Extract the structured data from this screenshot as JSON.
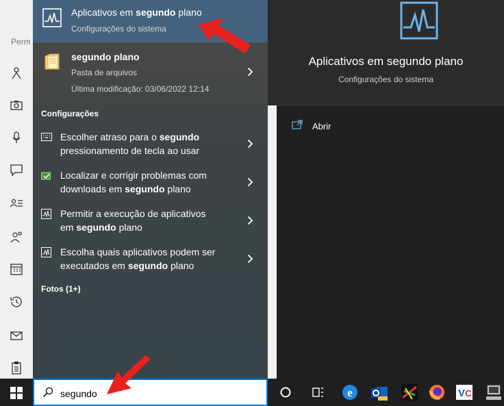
{
  "background_window": {
    "partial_label": "Perm",
    "icons": [
      "person-icon",
      "camera-icon",
      "microphone-icon",
      "chat-icon",
      "contacts-icon",
      "people-icon",
      "calendar-icon",
      "history-icon",
      "mail-icon",
      "clipboard-icon"
    ]
  },
  "top_result": {
    "title_pre": "Aplicativos em ",
    "title_bold": "segundo",
    "title_post": " plano",
    "subtitle": "Configurações do sistema",
    "icon": "activity-chart-icon"
  },
  "folder_result": {
    "title": "segundo plano",
    "type": "Pasta de arquivos",
    "modified": "Última modificação: 03/06/2022 12:14",
    "icon": "folder-icon"
  },
  "settings_section": {
    "header": "Configurações",
    "items": [
      {
        "line1_pre": "Escolher atraso para o ",
        "line1_bold": "segundo",
        "line1_post": "",
        "line2_pre": "pressionamento de tecla ao usar",
        "line2_bold": "",
        "line2_post": "",
        "icon": "keyboard-icon"
      },
      {
        "line1_pre": "Localizar e corrigir problemas com",
        "line1_bold": "",
        "line1_post": "",
        "line2_pre": "downloads em ",
        "line2_bold": "segundo",
        "line2_post": " plano",
        "icon": "troubleshoot-icon"
      },
      {
        "line1_pre": "Permitir a execução de aplicativos",
        "line1_bold": "",
        "line1_post": "",
        "line2_pre": "em ",
        "line2_bold": "segundo",
        "line2_post": " plano",
        "icon": "activity-chart-icon"
      },
      {
        "line1_pre": "Escolha quais aplicativos podem ser",
        "line1_bold": "",
        "line1_post": "",
        "line2_pre": "executados em ",
        "line2_bold": "segundo",
        "line2_post": " plano",
        "icon": "activity-chart-icon"
      }
    ]
  },
  "photos_section": {
    "header": "Fotos (1+)"
  },
  "detail": {
    "title": "Aplicativos em segundo plano",
    "subtitle": "Configurações do sistema",
    "open_label": "Abrir",
    "icon": "activity-chart-icon"
  },
  "search": {
    "query": "segundo",
    "icon": "search-icon"
  },
  "taskbar": {
    "icons": [
      "windows-start-icon",
      "cortana-icon",
      "task-view-icon",
      "edge-icon",
      "outlook-icon",
      "kaspersky-icon",
      "firefox-icon",
      "vnc-icon",
      "network-computer-icon"
    ]
  },
  "colors": {
    "accent": "#0078d7",
    "highlight": "#44627e",
    "annotation_arrow": "#e8211c"
  }
}
